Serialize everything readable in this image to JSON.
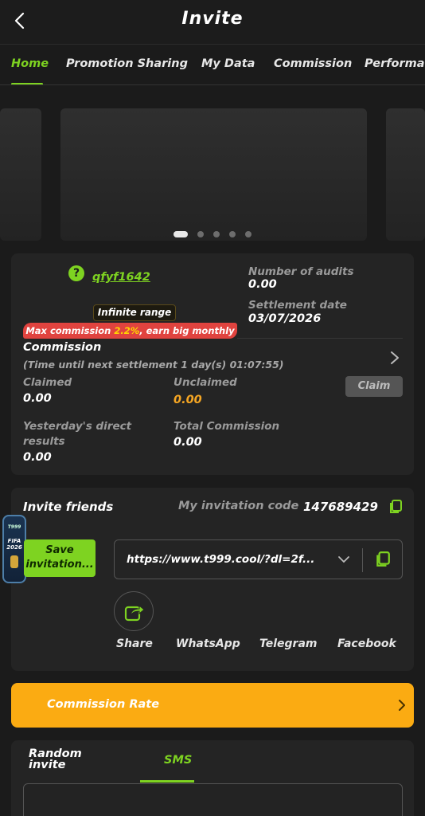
{
  "header": {
    "title": "Invite"
  },
  "tabs": [
    {
      "label": "Home"
    },
    {
      "label": "Promotion Sharing"
    },
    {
      "label": "My Data"
    },
    {
      "label": "Commission"
    },
    {
      "label": "Performa"
    }
  ],
  "summary": {
    "user_id": "qfyf1642",
    "range_badge": "Infinite range",
    "promo_prefix": "Max commission ",
    "promo_highlight": "2.2%",
    "promo_suffix": ", earn big monthly",
    "audits_label": "Number of audits",
    "audits_value": "0.00",
    "settlement_label": "Settlement date",
    "settlement_value": "03/07/2026"
  },
  "commission": {
    "title": "Commission",
    "countdown": "(Time until next settlement  1 day(s) 01:07:55)",
    "claimed_label": "Claimed",
    "claimed_value": "0.00",
    "unclaimed_label": "Unclaimed",
    "unclaimed_value": "0.00",
    "claim_button": "Claim",
    "yesterday_label_1": "Yesterday's direct",
    "yesterday_label_2": "results",
    "yesterday_value": "0.00",
    "total_label": "Total Commission",
    "total_value": "0.00"
  },
  "invite": {
    "title": "Invite friends",
    "code_label": "My invitation code",
    "code_value": "147689429",
    "save_line1": "Save",
    "save_line2": "invitation...",
    "link": "https://www.t999.cool/?dl=2f...",
    "fifa_text_1": "FIFA",
    "fifa_text_2": "2026",
    "share_options": [
      "Share",
      "WhatsApp",
      "Telegram",
      "Facebook"
    ]
  },
  "rate": {
    "label": "Commission Rate"
  },
  "bottom_tabs": {
    "random_1": "Random",
    "random_2": "invite",
    "sms": "SMS"
  },
  "colors": {
    "accent": "#7ed321",
    "orange": "#fbab12",
    "promo_red": "#e0433f",
    "unclaimed": "#f5a623"
  }
}
